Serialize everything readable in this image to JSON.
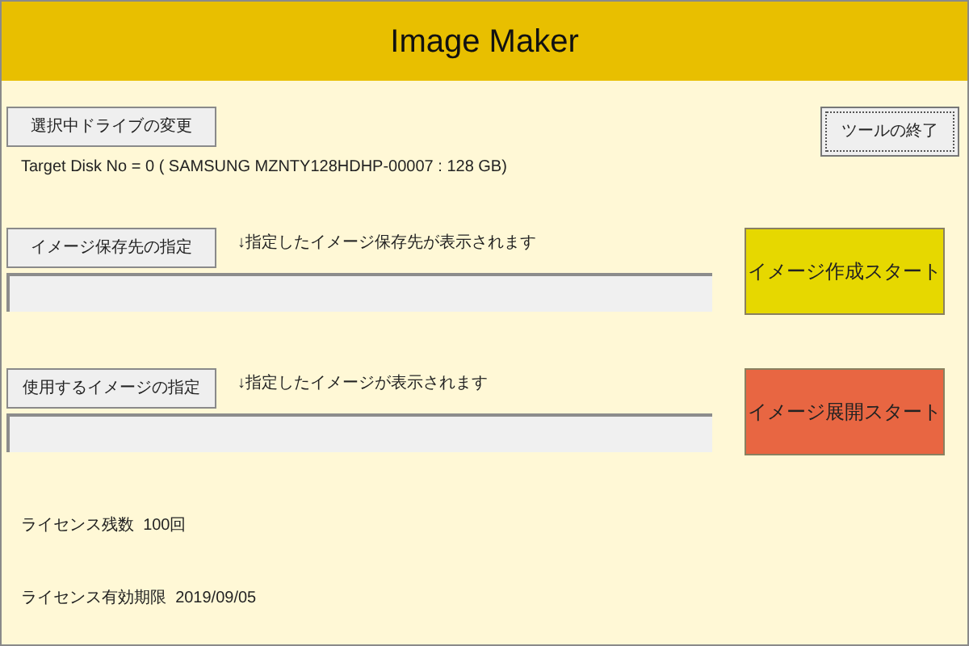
{
  "window": {
    "title": "Image Maker"
  },
  "drive": {
    "button": "選択中ドライブの変更",
    "target": "Target Disk No = 0 ( SAMSUNG MZNTY128HDHP-00007 : 128 GB)"
  },
  "exit_button": {
    "label": "ツールの終了",
    "focused": true
  },
  "sections": [
    {
      "button": "イメージ保存先の指定",
      "hint": "↓指定したイメージ保存先が表示されます",
      "action": "イメージ作成スタート",
      "color": "#e6d800"
    },
    {
      "button": "使用するイメージの指定",
      "hint": "↓指定したイメージが表示されます",
      "action": "イメージ展開スタート",
      "color": "#e86642"
    }
  ],
  "license": [
    {
      "label": "ライセンス残数",
      "value": "100回"
    },
    {
      "label": "ライセンス有効期限",
      "value": "2019/09/05"
    }
  ]
}
